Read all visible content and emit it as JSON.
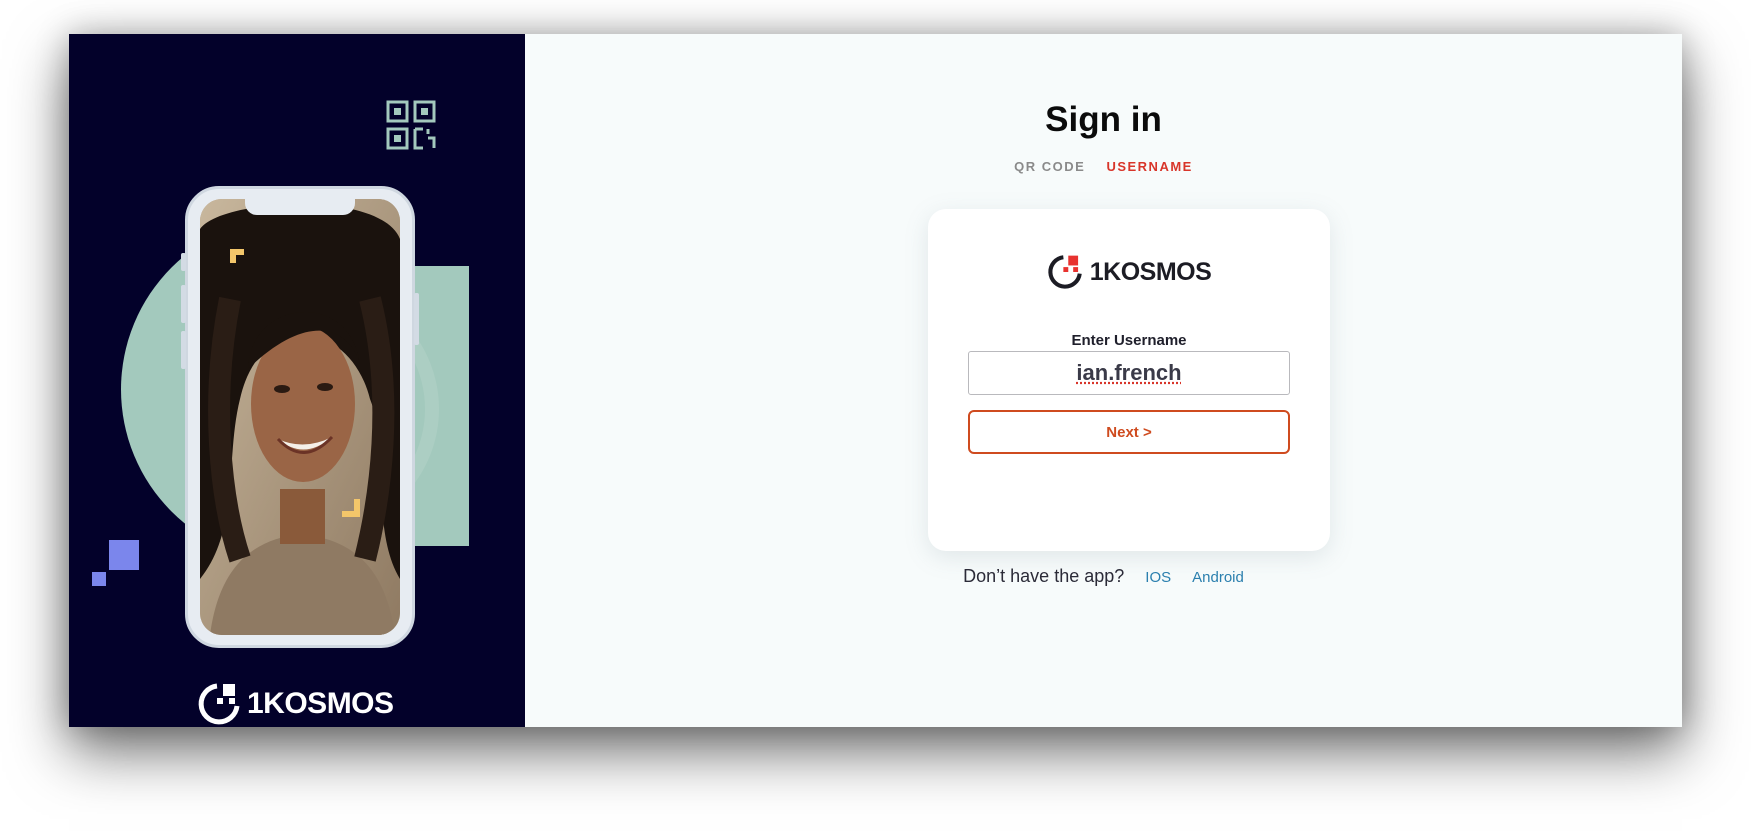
{
  "left_panel": {
    "brand_name": "1KOSMOS",
    "colors": {
      "background": "#03012a",
      "accent_teal": "#a3c9bd",
      "accent_purple": "#7b86ec",
      "frame_yellow": "#f3c66a"
    },
    "icons": [
      "qr-code-icon",
      "brand-logo-icon"
    ]
  },
  "signin": {
    "title": "Sign in",
    "tabs": [
      {
        "label": "QR CODE",
        "active": false
      },
      {
        "label": "USERNAME",
        "active": true
      }
    ]
  },
  "card": {
    "brand_name": "1KOSMOS",
    "field_label": "Enter Username",
    "username_value": "ian.french",
    "next_label": "Next >"
  },
  "footer": {
    "prompt": "Don’t have the app?",
    "links": [
      "IOS",
      "Android"
    ]
  },
  "colors": {
    "active_tab": "#d8352a",
    "button_accent": "#cf4b1f",
    "link": "#2a7fae",
    "page_bg": "#f7fbfb"
  }
}
